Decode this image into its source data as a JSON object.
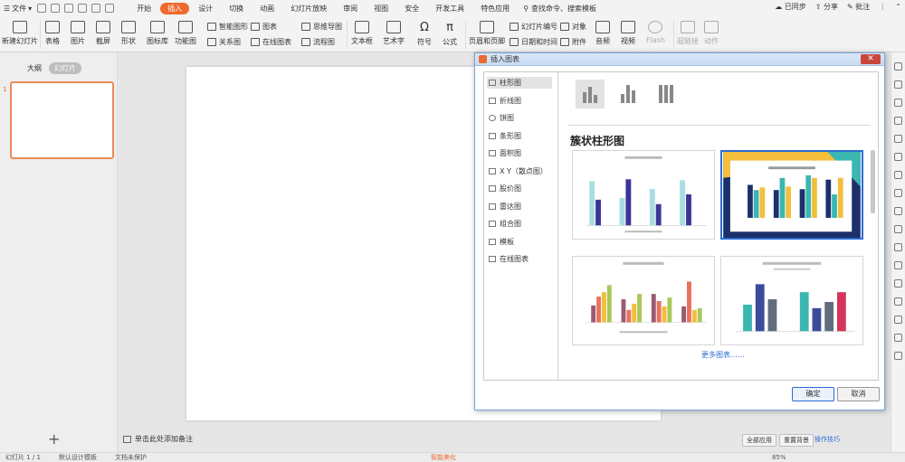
{
  "menubar": {
    "file_label": "文件",
    "tabs": [
      "开始",
      "插入",
      "设计",
      "切换",
      "动画",
      "幻灯片放映",
      "审阅",
      "视图",
      "安全",
      "开发工具",
      "特色应用"
    ],
    "active_tab": "插入",
    "search_placeholder": "查找命令、搜索模板",
    "sync_label": "已同步",
    "share_label": "分享",
    "comment_label": "批注"
  },
  "ribbon": {
    "new_slide": "新建幻灯片",
    "table": "表格",
    "picture": "图片",
    "screenshot": "截屏",
    "shape": "形状",
    "icon_lib": "图标库",
    "func_chart": "功能图",
    "smart_art": "智能图形",
    "relation": "关系图",
    "chart": "图表",
    "online_chart": "在线图表",
    "mind_map": "思维导图",
    "flow_chart": "流程图",
    "textbox": "文本框",
    "art_text": "艺术字",
    "symbol": "符号",
    "formula": "公式",
    "header_footer": "页眉和页脚",
    "slide_number": "幻灯片编号",
    "datetime": "日期和时间",
    "object": "对象",
    "attachment": "附件",
    "audio": "音频",
    "video": "视频",
    "flash": "Flash",
    "hyperlink": "超链接",
    "action": "动作"
  },
  "left_panel": {
    "tab_outline": "大纲",
    "tab_slides": "幻灯片",
    "slide_number": "1",
    "add_symbol": "+"
  },
  "notes_placeholder": "单击此处添加备注",
  "bottom_right": {
    "btn_all": "全部应用",
    "btn_reset": "重置背景",
    "link_tips": "操作技巧"
  },
  "statusbar": {
    "slide_info": "幻灯片 1 / 1",
    "design": "默认设计模板",
    "protect": "文档未保护",
    "smart": "智能美化",
    "zoom": "85%"
  },
  "dialog": {
    "title": "插入图表",
    "close": "✕",
    "categories": [
      "柱形图",
      "折线图",
      "饼图",
      "条形图",
      "面积图",
      "X Y（散点图）",
      "股价图",
      "雷达图",
      "组合图",
      "模板",
      "在线图表"
    ],
    "selected_category": "柱形图",
    "heading": "簇状柱形图",
    "more_charts": "更多图表……",
    "ok": "确定",
    "cancel": "取消"
  }
}
